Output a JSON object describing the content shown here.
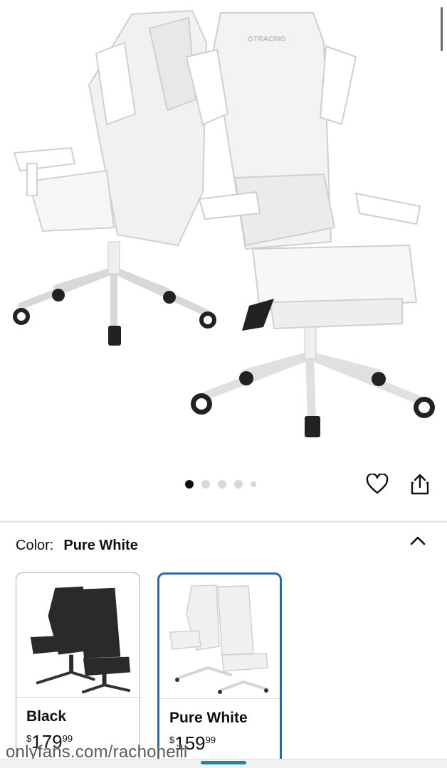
{
  "product": {
    "brand_mark": "GTRACING",
    "image_count": 5,
    "active_image_index": 0
  },
  "icons": {
    "wishlist": "heart-icon",
    "share": "share-icon",
    "collapse": "chevron-up-icon"
  },
  "color_selector": {
    "label": "Color:",
    "selected": "Pure White",
    "options": [
      {
        "name": "Black",
        "currency": "$",
        "whole": "179",
        "fraction": "99",
        "selected": false
      },
      {
        "name": "Pure White",
        "currency": "$",
        "whole": "159",
        "fraction": "99",
        "selected": true
      }
    ]
  },
  "watermark": "onlyfans.com/rachoneill",
  "colors": {
    "selected_border": "#2b6aa6",
    "text": "#0f1111",
    "active_dot": "#0f1111",
    "inactive_dot": "#d5d9d9"
  }
}
